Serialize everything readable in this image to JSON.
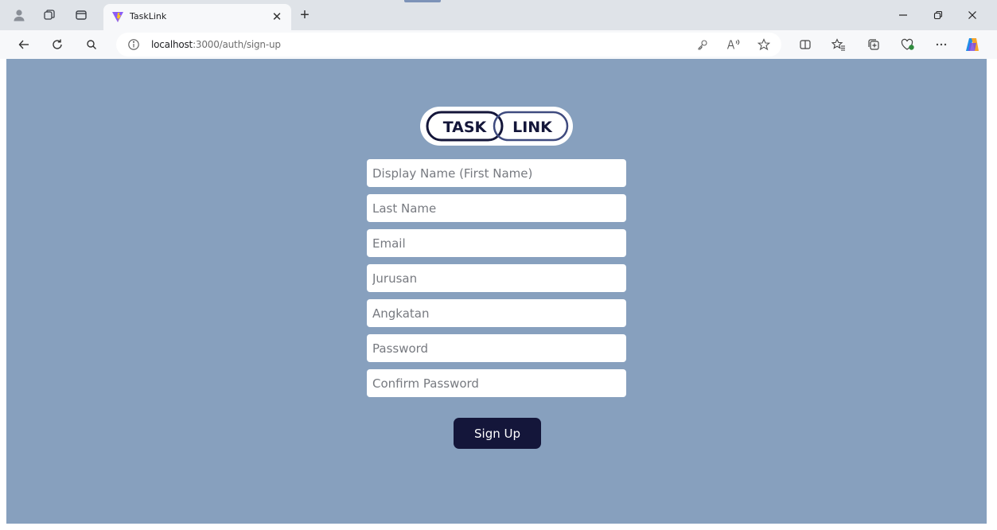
{
  "browser": {
    "tab_title": "TaskLink",
    "url_host": "localhost",
    "url_path": ":3000/auth/sign-up",
    "icons": [
      "profile-icon",
      "workspaces-icon",
      "tab-actions-icon",
      "vite-favicon",
      "close-icon",
      "new-tab-icon",
      "minimize-icon",
      "restore-icon",
      "window-close-icon",
      "back-icon",
      "refresh-icon",
      "search-icon",
      "info-icon",
      "key-icon",
      "read-aloud-icon",
      "favorite-star-icon",
      "split-screen-icon",
      "favorites-icon",
      "collections-icon",
      "browser-essentials-icon",
      "more-icon",
      "copilot-icon"
    ]
  },
  "page": {
    "background_color": "#87a0be",
    "logo": {
      "left_text": "TASK",
      "right_text": "LINK"
    },
    "form": {
      "fields": [
        {
          "placeholder": "Display Name (First Name)",
          "value": ""
        },
        {
          "placeholder": "Last Name",
          "value": ""
        },
        {
          "placeholder": "Email",
          "value": ""
        },
        {
          "placeholder": "Jurusan",
          "value": ""
        },
        {
          "placeholder": "Angkatan",
          "value": ""
        },
        {
          "placeholder": "Password",
          "value": ""
        },
        {
          "placeholder": "Confirm Password",
          "value": ""
        }
      ],
      "submit_label": "Sign Up",
      "submit_color": "#14163a"
    }
  }
}
